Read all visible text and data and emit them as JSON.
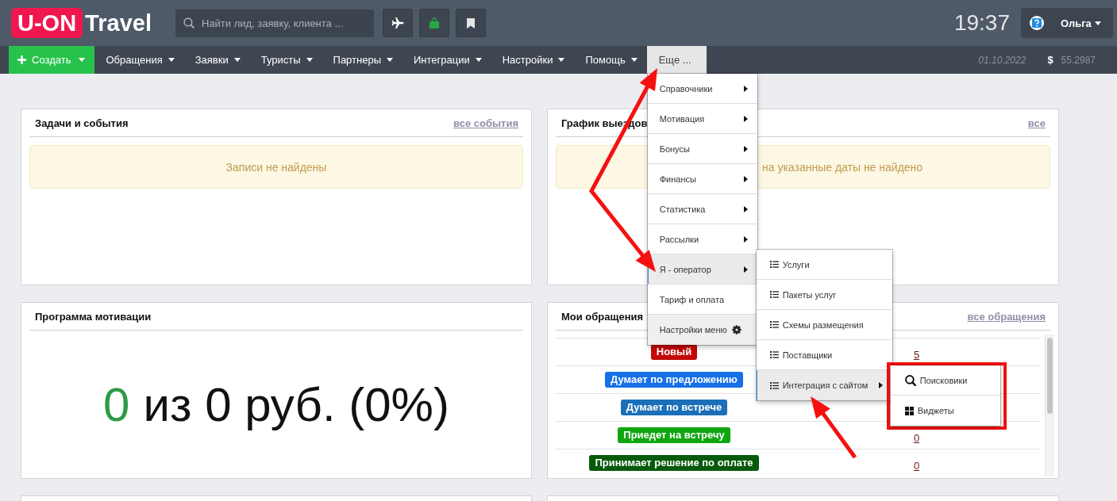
{
  "header": {
    "logo": {
      "badge": "U-ON",
      "text": "Travel"
    },
    "search": {
      "placeholder": "Найти лид, заявку, клиента ..."
    },
    "clock": "19:37",
    "user": {
      "name": "Ольга"
    }
  },
  "nav": {
    "items": [
      {
        "kind": "create",
        "label": "Создать",
        "expanded": false
      },
      {
        "kind": "menu",
        "label": "Обращения",
        "expanded": false
      },
      {
        "kind": "menu",
        "label": "Заявки",
        "expanded": false
      },
      {
        "kind": "menu",
        "label": "Туристы",
        "expanded": false
      },
      {
        "kind": "menu",
        "label": "Партнеры",
        "expanded": false
      },
      {
        "kind": "menu",
        "label": "Интеграции",
        "expanded": false
      },
      {
        "kind": "menu",
        "label": "Настройки",
        "expanded": false
      },
      {
        "kind": "menu",
        "label": "Помощь",
        "expanded": false
      },
      {
        "kind": "more",
        "label": "Еще ...",
        "expanded": true,
        "menu": {
          "items": [
            {
              "kind": "plain",
              "label": "Справочники",
              "has_submenu": true,
              "active": false
            },
            {
              "kind": "plain",
              "label": "Мотивация",
              "has_submenu": true,
              "active": false
            },
            {
              "kind": "plain",
              "label": "Бонусы",
              "has_submenu": true,
              "active": false
            },
            {
              "kind": "plain",
              "label": "Финансы",
              "has_submenu": true,
              "active": false
            },
            {
              "kind": "plain",
              "label": "Статистика",
              "has_submenu": true,
              "active": false
            },
            {
              "kind": "plain",
              "label": "Рассылки",
              "has_submenu": true,
              "active": false
            },
            {
              "kind": "plain",
              "label": "Я - оператор",
              "has_submenu": true,
              "active": true,
              "submenu": {
                "items": [
                  {
                    "kind": "list",
                    "label": "Услуги",
                    "has_submenu": false,
                    "active": false
                  },
                  {
                    "kind": "list",
                    "label": "Пакеты услуг",
                    "has_submenu": false,
                    "active": false
                  },
                  {
                    "kind": "list",
                    "label": "Схемы размещения",
                    "has_submenu": false,
                    "active": false
                  },
                  {
                    "kind": "list",
                    "label": "Поставщики",
                    "has_submenu": false,
                    "active": false
                  },
                  {
                    "kind": "list",
                    "label": "Интеграция с сайтом",
                    "has_submenu": true,
                    "active": true,
                    "submenu": {
                      "framed": true,
                      "items": [
                        {
                          "kind": "search",
                          "label": "Поисковики",
                          "has_submenu": false,
                          "active": false
                        },
                        {
                          "kind": "widgets",
                          "label": "Виджеты",
                          "has_submenu": false,
                          "active": false
                        }
                      ]
                    }
                  }
                ]
              }
            },
            {
              "kind": "plain",
              "label": "Тариф и оплата",
              "has_submenu": false,
              "active": false
            },
            {
              "kind": "settings",
              "label": "Настройки меню",
              "has_submenu": false,
              "active": false
            }
          ]
        }
      }
    ],
    "date": "01.10.2022",
    "currency": {
      "symbol": "$",
      "rate": "55.2987"
    }
  },
  "panels": [
    {
      "kind": "alert",
      "title": "Задачи и события",
      "link": "все события",
      "message": "Записи не найдены"
    },
    {
      "kind": "alert",
      "title": "График выездов",
      "link": "все",
      "message": "на указанные даты не найдено"
    },
    {
      "kind": "motivation",
      "title": "Программа мотивации",
      "achieved": "0",
      "total": "из 0 руб. (0%)"
    },
    {
      "kind": "statuses",
      "title": "Мои обращения",
      "link": "все обращения",
      "rows": [
        {
          "status": "Новый",
          "color": "#c40808",
          "count": "5"
        },
        {
          "status": "Думает по предложению",
          "color": "#1670e6"
        },
        {
          "status": "Думает по встрече",
          "color": "#1b6fb8"
        },
        {
          "status": "Приедет на встречу",
          "color": "#10a610",
          "count": "0"
        },
        {
          "status": "Принимает решение по оплате",
          "color": "#075a0b",
          "count": "0"
        }
      ]
    },
    {
      "kind": "empty"
    },
    {
      "kind": "empty"
    }
  ],
  "annotations": [
    {
      "kind": "double-arrow"
    },
    {
      "kind": "arrow"
    }
  ]
}
